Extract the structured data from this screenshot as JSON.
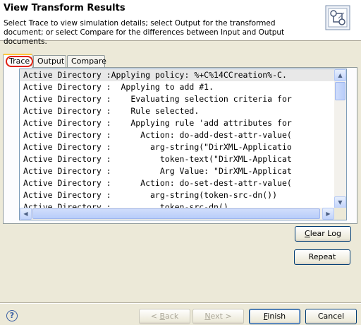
{
  "banner": {
    "title": "View Transform Results",
    "description": "Select Trace to view simulation details; select Output for the transformed document; or select Compare for the differences between Input and Output documents.",
    "icon": "transform-wizard-icon"
  },
  "tabs": [
    {
      "label": "Trace",
      "selected": true
    },
    {
      "label": "Output",
      "selected": false
    },
    {
      "label": "Compare",
      "selected": false
    }
  ],
  "trace": {
    "lines": [
      "Active Directory :Applying policy: %+C%14CCreation%-C.",
      "Active Directory :  Applying to add #1.",
      "Active Directory :    Evaluating selection criteria for",
      "Active Directory :    Rule selected.",
      "Active Directory :    Applying rule 'add attributes for",
      "Active Directory :      Action: do-add-dest-attr-value(",
      "Active Directory :        arg-string(\"DirXML-Applicatio",
      "Active Directory :          token-text(\"DirXML-Applicat",
      "Active Directory :          Arg Value: \"DirXML-Applicat",
      "Active Directory :      Action: do-set-dest-attr-value(",
      "Active Directory :        arg-string(token-src-dn())",
      "Active Directory :          token-src-dn()"
    ],
    "selected_line": 0
  },
  "buttons": {
    "clear_log": {
      "pre": "",
      "mn": "C",
      "post": "lear Log"
    },
    "repeat": "Repeat",
    "back": {
      "pre": "< ",
      "mn": "B",
      "post": "ack"
    },
    "next": {
      "pre": "",
      "mn": "N",
      "post": "ext >"
    },
    "finish": {
      "pre": "",
      "mn": "F",
      "post": "inish"
    },
    "cancel": "Cancel"
  },
  "help_icon": "help-icon",
  "colors": {
    "accent_ring": "#e02010",
    "tab_highlight": "#ffc83c",
    "button_border": "#003c74"
  }
}
